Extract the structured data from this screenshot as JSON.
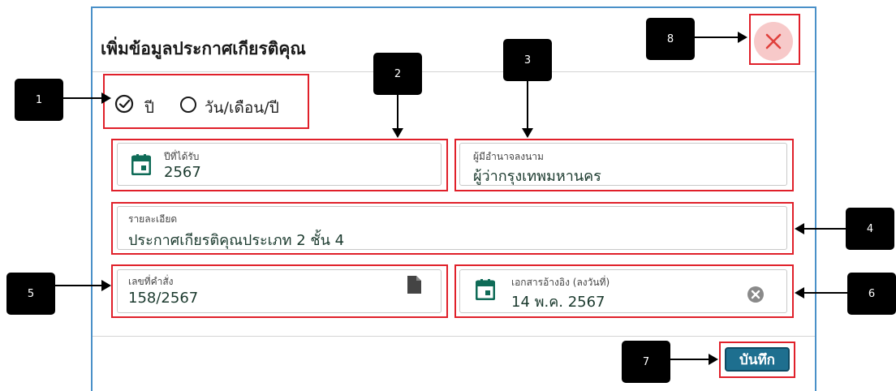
{
  "dialog": {
    "title": "เพิ่มข้อมูลประกาศเกียรติคุณ",
    "save_label": "บันทึก"
  },
  "date_mode": {
    "options": [
      {
        "label": "ปี",
        "selected": true
      },
      {
        "label": "วัน/เดือน/ปี",
        "selected": false
      }
    ]
  },
  "fields": {
    "year": {
      "label": "ปีที่ได้รับ",
      "value": "2567"
    },
    "authority": {
      "label": "ผู้มีอำนาจลงนาม",
      "value": "ผู้ว่ากรุงเทพมหานคร"
    },
    "detail": {
      "label": "รายละเอียด",
      "value": "ประกาศเกียรติคุณประเภท 2 ชั้น 4"
    },
    "order_no": {
      "label": "เลขที่คำสั่ง",
      "value": "158/2567"
    },
    "ref_doc": {
      "label": "เอกสารอ้างอิง (ลงวันที่)",
      "value": "14 พ.ค. 2567"
    }
  },
  "markers": [
    "1",
    "2",
    "3",
    "4",
    "5",
    "6",
    "7",
    "8"
  ],
  "colors": {
    "accent": "#1e6f8f",
    "calendar_icon": "#0f6b57",
    "highlight": "#e0202a",
    "close_bg": "#f7c9c9",
    "close_x": "#e0403c"
  }
}
